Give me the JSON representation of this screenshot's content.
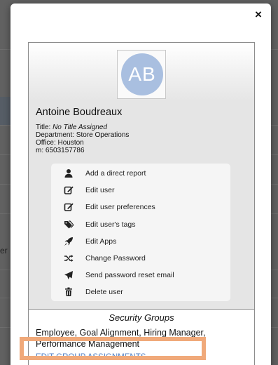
{
  "modal": {
    "close_label": "×",
    "avatar_initials": "AB",
    "user": {
      "name": "Antoine Boudreaux",
      "title_label": "Title: ",
      "title_value": "No Title Assigned",
      "department": "Department: Store Operations",
      "office": "Office: Houston",
      "mobile": "m: 6503157786"
    },
    "menu": [
      {
        "label": "Add a direct report",
        "icon": "person-icon"
      },
      {
        "label": "Edit user",
        "icon": "edit-icon"
      },
      {
        "label": "Edit user preferences",
        "icon": "edit-icon"
      },
      {
        "label": "Edit user's tags",
        "icon": "tags-icon"
      },
      {
        "label": "Edit Apps",
        "icon": "rocket-icon"
      },
      {
        "label": "Change Password",
        "icon": "shuffle-icon"
      },
      {
        "label": "Send password reset email",
        "icon": "send-icon"
      },
      {
        "label": "Delete user",
        "icon": "trash-icon"
      }
    ],
    "security": {
      "title": "Security Groups",
      "groups": "Employee, Goal Alignment, Hiring Manager, Performance Management",
      "edit_link": "EDIT GROUP ASSIGNMENTS"
    }
  },
  "backdrop": {
    "partial_text": "er"
  },
  "colors": {
    "avatar": "#a9bfe0",
    "link": "#4f7fc4",
    "highlight": "#f0a97a"
  }
}
